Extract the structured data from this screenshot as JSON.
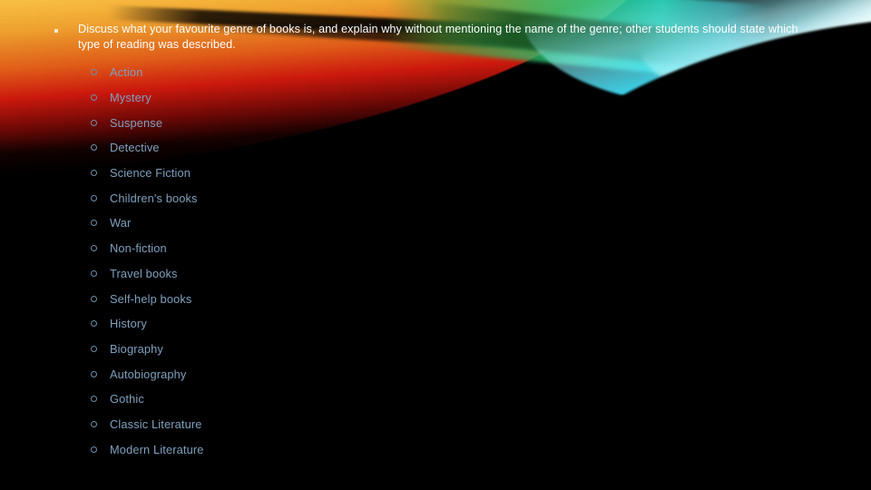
{
  "slide": {
    "background_color": "#000000",
    "artwork": {
      "name": "colorful-light-streaks-banner",
      "warm_colors": [
        "#fddb70",
        "#f3a32f",
        "#e75f19",
        "#d61a0e"
      ],
      "green_color": "#28be6e",
      "cyan_colors": [
        "#3ce2fa",
        "#e4fdff",
        "#12c4e4"
      ]
    }
  },
  "lead": {
    "bullet": "square-bullet",
    "text": "Discuss what your favourite genre of books is, and explain why without mentioning the name of the genre; other students should state which type of reading was described.",
    "text_color": "#ffffff"
  },
  "genres": {
    "marker": "hollow-circle-bullet",
    "text_color": "#7fa0bd",
    "items": [
      {
        "label": "Action"
      },
      {
        "label": "Mystery"
      },
      {
        "label": "Suspense"
      },
      {
        "label": "Detective"
      },
      {
        "label": "Science Fiction"
      },
      {
        "label": "Children's books"
      },
      {
        "label": "War"
      },
      {
        "label": "Non-fiction"
      },
      {
        "label": "Travel books"
      },
      {
        "label": "Self-help books"
      },
      {
        "label": "History"
      },
      {
        "label": "Biography"
      },
      {
        "label": "Autobiography"
      },
      {
        "label": "Gothic"
      },
      {
        "label": "Classic Literature"
      },
      {
        "label": "Modern Literature"
      }
    ]
  }
}
